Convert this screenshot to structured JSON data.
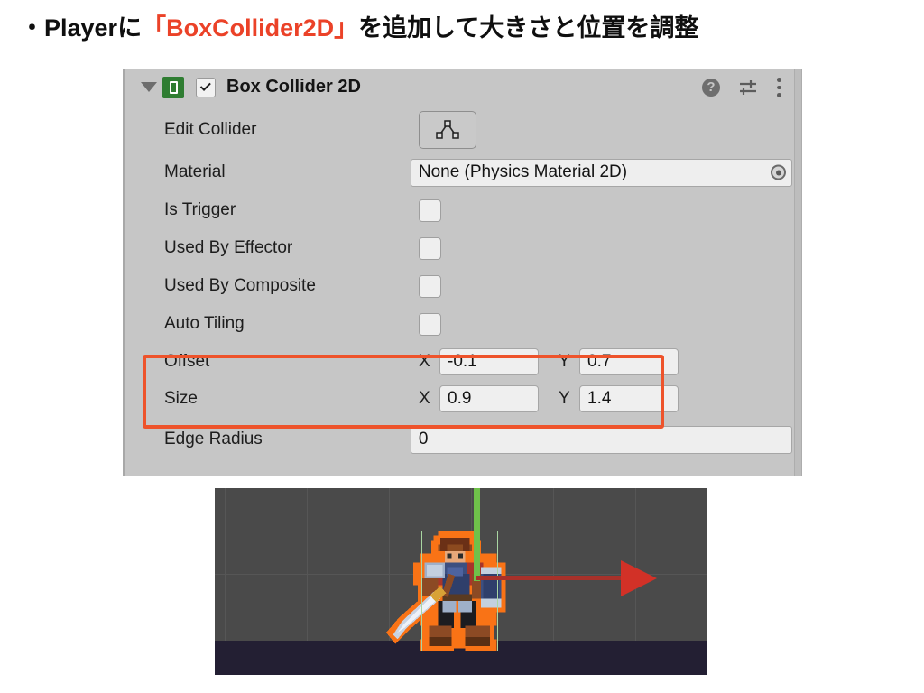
{
  "slide": {
    "headline_prefix": "・Playerに",
    "headline_accent": "「BoxCollider2D」",
    "headline_suffix": "を追加して大きさと位置を調整",
    "accent_color": "#eb4228"
  },
  "inspector": {
    "component_title": "Box Collider 2D",
    "enabled": true,
    "foldout_expanded": true,
    "icons": {
      "foldout": "chevron-down-icon",
      "component": "box-collider-2d-icon",
      "help": "help-icon",
      "help_glyph": "?",
      "preset": "preset-sliders-icon",
      "menu": "kebab-menu-icon"
    },
    "rows": [
      {
        "label": "Edit Collider",
        "type": "button",
        "icon": "edit-collider-icon"
      },
      {
        "label": "Material",
        "type": "object",
        "value": "None (Physics Material 2D)",
        "picker": "object-picker-icon"
      },
      {
        "label": "Is Trigger",
        "type": "checkbox",
        "checked": false
      },
      {
        "label": "Used By Effector",
        "type": "checkbox",
        "checked": false
      },
      {
        "label": "Used By Composite",
        "type": "checkbox",
        "checked": false
      },
      {
        "label": "Auto Tiling",
        "type": "checkbox",
        "checked": false
      }
    ],
    "vectors": {
      "highlight_color": "#ee532b",
      "offset": {
        "label": "Offset",
        "x_axis": "X",
        "x": "-0.1",
        "y_axis": "Y",
        "y": "0.7"
      },
      "size": {
        "label": "Size",
        "x_axis": "X",
        "x": "0.9",
        "y_axis": "Y",
        "y": "1.4"
      }
    },
    "edge_radius": {
      "label": "Edge Radius",
      "value": "0"
    },
    "colors": {
      "panel_bg": "#c6c6c6",
      "field_bg": "#eeeeee",
      "component_icon": "#2f7d32"
    }
  },
  "scene": {
    "background": "#4a4a4a",
    "ground_color": "#231f33",
    "grid_color": "#565656",
    "collider_outline": "#a9d6a2",
    "gizmo_y_color": "#6fc14a",
    "gizmo_x_color": "#d23127",
    "selection_outline": "#f97316",
    "sprite_name": "player-knight-sprite"
  }
}
